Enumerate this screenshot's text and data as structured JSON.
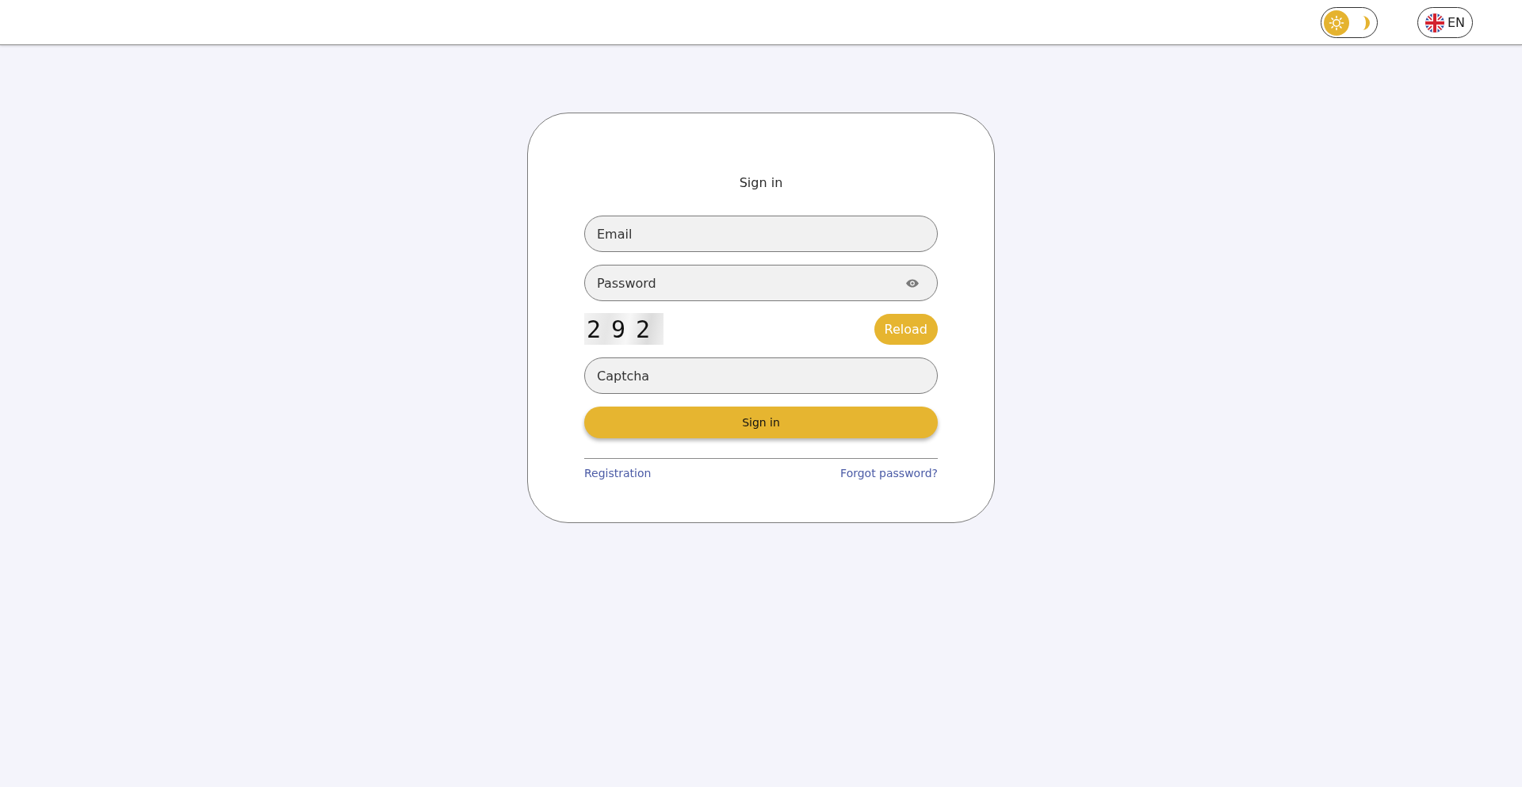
{
  "header": {
    "theme_toggle": {
      "dark": false
    },
    "language": {
      "code": "EN"
    }
  },
  "card": {
    "title": "Sign in",
    "fields": [
      {
        "kind": "email",
        "placeholder": "Email"
      },
      {
        "kind": "password",
        "placeholder": "Password"
      }
    ],
    "captcha": {
      "code": "292",
      "reload": "Reload",
      "field": {
        "placeholder": "Captcha"
      }
    },
    "submit": "Sign in",
    "links": [
      {
        "label": "Registration"
      },
      {
        "label": "Forgot password?"
      }
    ]
  }
}
